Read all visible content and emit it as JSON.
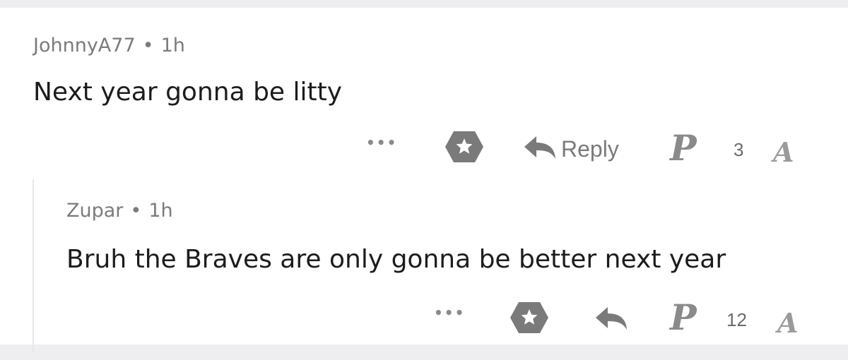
{
  "comments": [
    {
      "author": "JohnnyA77",
      "separator": "•",
      "age": "1h",
      "text": "Next year gonna be litty",
      "more_label": "•••",
      "reply_label": "Reply",
      "team_p_label": "P",
      "score": "3",
      "team_a_label": "A"
    },
    {
      "author": "Zupar",
      "separator": "•",
      "age": "1h",
      "text": "Bruh the Braves are only gonna be better next year",
      "more_label": "•••",
      "team_p_label": "P",
      "score": "12",
      "team_a_label": "A"
    }
  ],
  "icons": {
    "award": "award-star-icon",
    "reply": "reply-arrow-icon",
    "more": "more-options-icon"
  },
  "colors": {
    "background": "#eeeef0",
    "card": "#ffffff",
    "icon_gray": "#7a7a7a",
    "text": "#1c1c1c",
    "meta": "#7b7b7b"
  }
}
